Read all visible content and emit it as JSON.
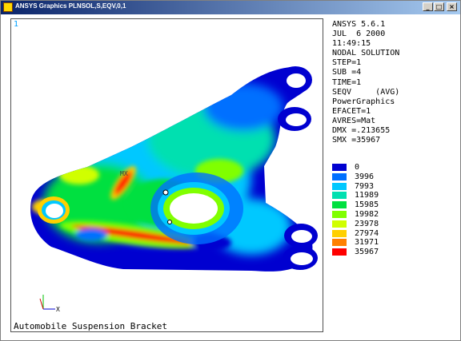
{
  "window": {
    "title": "ANSYS Graphics   PLNSOL,S,EQV,0,1"
  },
  "plot": {
    "window_number": "1",
    "caption": "Automobile Suspension Bracket",
    "max_marker": "MX",
    "triad_x": "X"
  },
  "info_lines": [
    "ANSYS 5.6.1",
    "JUL  6 2000",
    "11:49:15",
    "NODAL SOLUTION",
    "STEP=1",
    "SUB =4",
    "TIME=1",
    "SEQV     (AVG)",
    "PowerGraphics",
    "EFACET=1",
    "AVRES=Mat",
    "DMX =.213655",
    "SMX =35967"
  ],
  "legend": [
    {
      "value": "0",
      "color": "#0000d0"
    },
    {
      "value": "3996",
      "color": "#0070ff"
    },
    {
      "value": "7993",
      "color": "#00c8ff"
    },
    {
      "value": "11989",
      "color": "#00e0b0"
    },
    {
      "value": "15985",
      "color": "#00e040"
    },
    {
      "value": "19982",
      "color": "#80ff00"
    },
    {
      "value": "23978",
      "color": "#d0ff00"
    },
    {
      "value": "27974",
      "color": "#ffd000"
    },
    {
      "value": "31971",
      "color": "#ff8000"
    },
    {
      "value": "35967",
      "color": "#ff0000"
    }
  ]
}
